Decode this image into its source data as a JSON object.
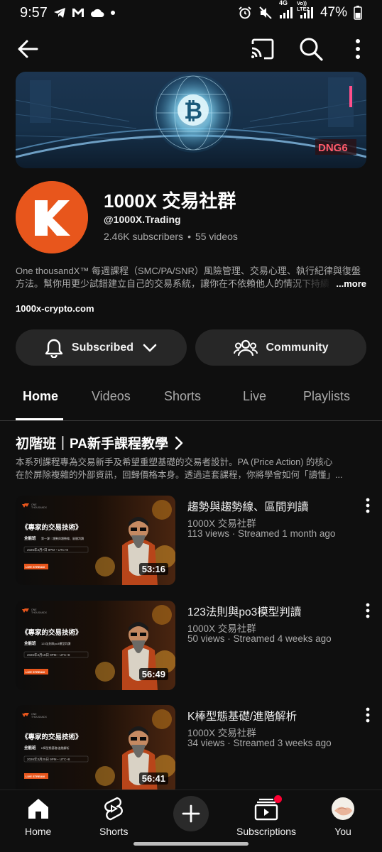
{
  "status_bar": {
    "time": "9:57",
    "network_4g": "4G",
    "network_lte": "Vo)) LTE2",
    "battery": "47%"
  },
  "channel": {
    "name": "1000X 交易社群",
    "handle": "@1000X.Trading",
    "subscribers": "2.46K subscribers",
    "separator": "•",
    "videos": "55 videos",
    "description_line1": "One thousandX™ 每週課程（SMC/PA/SNR）風險管理、交易心理、執行紀律與復盤",
    "description_line2": "方法。幫你用更少試錯建立自己的交易系統，讓你在不依賴他人的情況下持續",
    "more_label": "...more",
    "website": "1000x-crypto.com",
    "banner_badge": "DNG6"
  },
  "actions": {
    "subscribed_label": "Subscribed",
    "community_label": "Community"
  },
  "tabs": [
    {
      "label": "Home",
      "active": true
    },
    {
      "label": "Videos",
      "active": false
    },
    {
      "label": "Shorts",
      "active": false
    },
    {
      "label": "Live",
      "active": false
    },
    {
      "label": "Playlists",
      "active": false
    }
  ],
  "section": {
    "title": "初階班｜PA新手課程教學",
    "desc_line1": "本系列課程專為交易新手及希望重塑基礎的交易者設計。PA (Price Action) 的核心",
    "desc_line2": "在於屏除複雜的外部資訊，回歸價格本身。透過這套課程，你將學會如何「讀懂」..."
  },
  "videos": [
    {
      "title": "趨勢與趨勢線、區間判讀",
      "channel": "1000X 交易社群",
      "meta": "113 views · Streamed 1 month ago",
      "duration": "53:16",
      "thumb_title": "《專家的交易技術》",
      "thumb_level": "全能班",
      "thumb_topic": "第一課｜趨勢與趨勢線、區間判讀",
      "thumb_date": "2026年3月7日 9PM・UTC+8",
      "thumb_tag": "LIVE STREAM"
    },
    {
      "title": "123法則與po3模型判讀",
      "channel": "1000X 交易社群",
      "meta": "50 views · Streamed 4 weeks ago",
      "duration": "56:49",
      "thumb_title": "《專家的交易技術》",
      "thumb_level": "全能班",
      "thumb_topic": "123法則與po3模型判讀",
      "thumb_date": "2026年3月18日 9PM・UTC+8",
      "thumb_tag": "LIVE STREAM"
    },
    {
      "title": "K棒型態基礎/進階解析",
      "channel": "1000X 交易社群",
      "meta": "34 views · Streamed 3 weeks ago",
      "duration": "56:41",
      "thumb_title": "《專家的交易技術》",
      "thumb_level": "全能班",
      "thumb_topic": "K棒型態基礎/進階解析",
      "thumb_date": "2026年3月25日 9PM・UTC+8",
      "thumb_tag": "LIVE STREAM"
    }
  ],
  "nav": {
    "home": "Home",
    "shorts": "Shorts",
    "subscriptions": "Subscriptions",
    "you": "You"
  },
  "colors": {
    "background": "#0f0f0f",
    "button_bg": "#272727",
    "brand_orange": "#e8561c",
    "notification_red": "#ff0033"
  }
}
